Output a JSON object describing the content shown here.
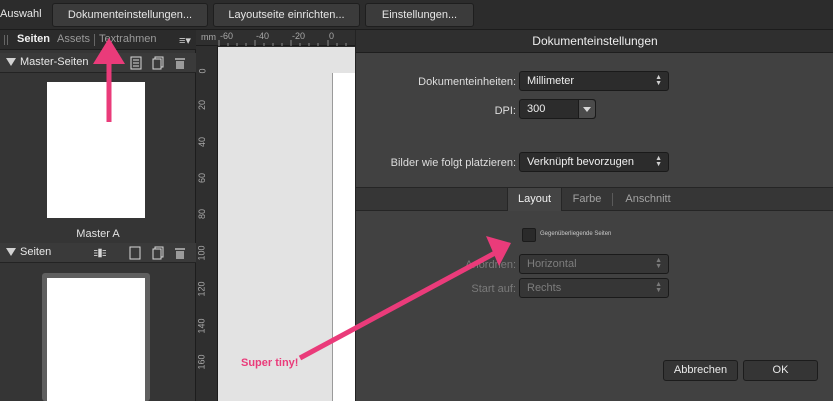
{
  "toolbar": {
    "mode_label": "Auswahl",
    "buttons": [
      "Dokumenteinstellungen...",
      "Layoutseite einrichten...",
      "Einstellungen..."
    ]
  },
  "panel": {
    "tabs": [
      "Seiten",
      "Assets",
      "Textrahmen"
    ],
    "active_tab": "Seiten",
    "master_section": "Master-Seiten",
    "master_thumb_label": "Master A",
    "pages_section": "Seiten"
  },
  "ruler": {
    "unit": "mm",
    "top_numbers": [
      "-60",
      "-40",
      "-20",
      "0"
    ],
    "left_numbers": [
      "0",
      "20",
      "40",
      "60",
      "80",
      "100",
      "120",
      "140",
      "160"
    ]
  },
  "dialog": {
    "title": "Dokumenteinstellungen",
    "units_label": "Dokumenteinheiten:",
    "units_value": "Millimeter",
    "dpi_label": "DPI:",
    "dpi_value": "300",
    "place_label": "Bilder wie folgt platzieren:",
    "place_value": "Verknüpft bevorzugen",
    "tabs": [
      "Layout",
      "Farbe",
      "Anschnitt"
    ],
    "active_tab": "Layout",
    "facing_pages_label": "Gegenüberliegende Seiten",
    "facing_pages_checked": false,
    "arrange_label": "Anordnen:",
    "arrange_value": "Horizontal",
    "start_label": "Start auf:",
    "start_value": "Rechts",
    "cancel_label": "Abbrechen",
    "ok_label": "OK"
  },
  "annotation": {
    "text": "Super tiny!",
    "color": "#ea3b7a"
  },
  "colors": {
    "panel_bg": "#353535",
    "dialog_bg": "#414141",
    "canvas_bg": "#e3e3e3",
    "annotation": "#ea3b7a"
  }
}
